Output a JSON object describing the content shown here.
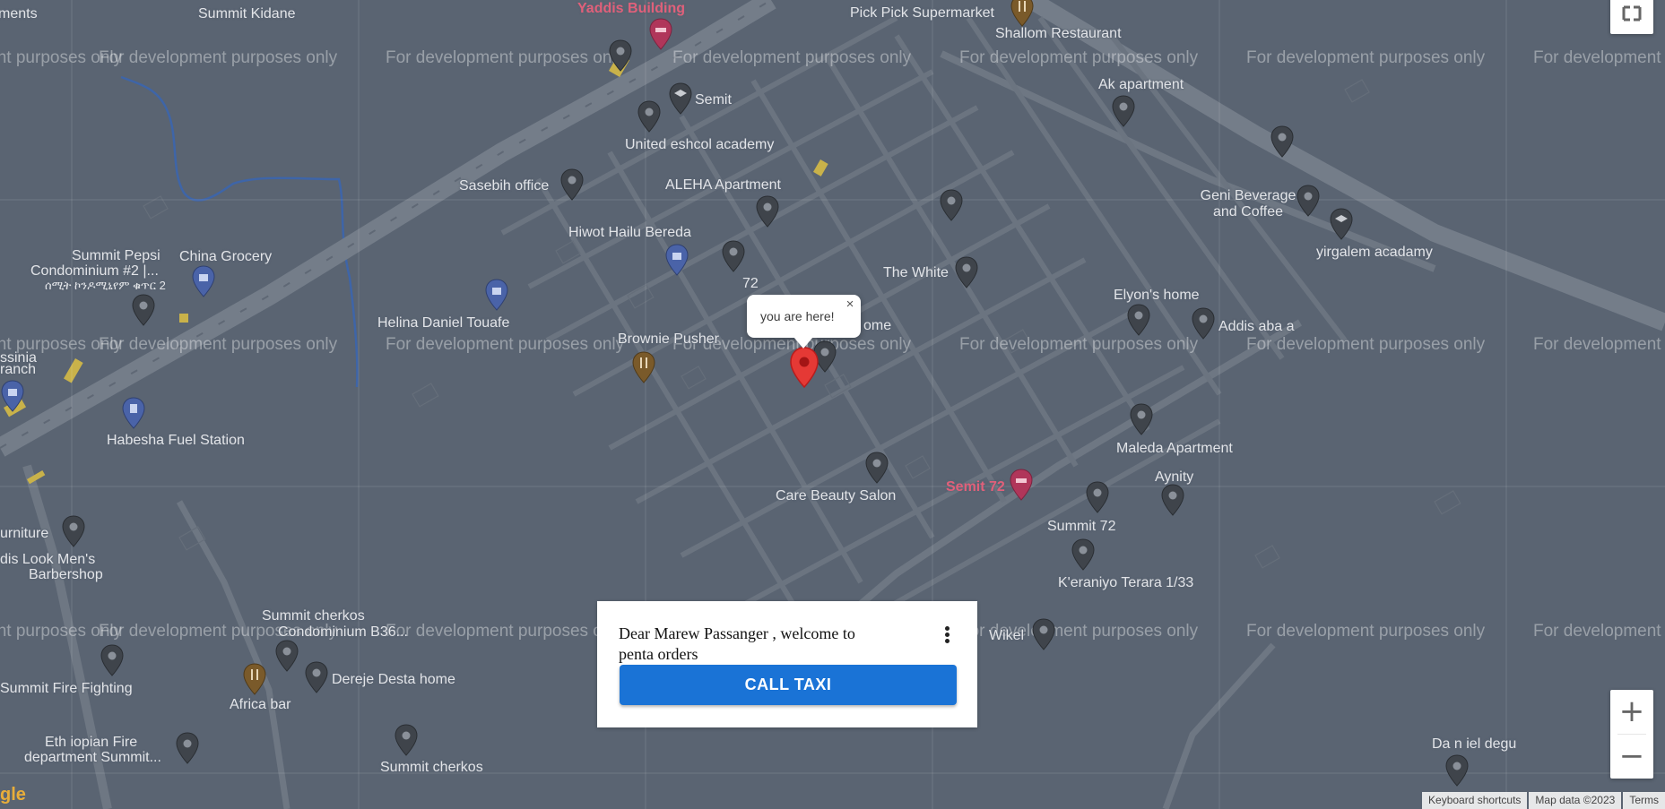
{
  "map": {
    "watermark": "For development purposes only",
    "user_marker_label": "you are here!",
    "close_label": "×",
    "places": [
      {
        "label": "ments"
      },
      {
        "label": "Summit Kidane"
      },
      {
        "label": "Yaddis Building"
      },
      {
        "label": "Pick Pick Supermarket"
      },
      {
        "label": "Shallom Restaurant"
      },
      {
        "label": "Semit"
      },
      {
        "label": "United eshcol academy"
      },
      {
        "label": "Ak apartment"
      },
      {
        "label": "Sasebih office"
      },
      {
        "label": "ALEHA Apartment"
      },
      {
        "label": "Geni Beverage and Coffee"
      },
      {
        "label": "Hiwot Hailu Bereda"
      },
      {
        "label": "yirgalem acadamy"
      },
      {
        "label": "Summit Pepsi"
      },
      {
        "label": "China Grocery"
      },
      {
        "label": "Condominium #2 |..."
      },
      {
        "label": "ሰሚት ኮንዶሚኒየም ቁጥር 2"
      },
      {
        "label": "72"
      },
      {
        "label": "The White"
      },
      {
        "label": "Elyon's home"
      },
      {
        "label": "Helina Daniel Touafe"
      },
      {
        "label": "Addis aba a"
      },
      {
        "label": "Brownie Pusher"
      },
      {
        "label": "ome"
      },
      {
        "label": "ssinia"
      },
      {
        "label": "ranch"
      },
      {
        "label": "Habesha Fuel Station"
      },
      {
        "label": "Maleda Apartment"
      },
      {
        "label": "Aynity"
      },
      {
        "label": "Care Beauty Salon"
      },
      {
        "label": "Semit 72"
      },
      {
        "label": "Summit 72"
      },
      {
        "label": "urniture"
      },
      {
        "label": "dis Look Men's"
      },
      {
        "label": "Barbershop"
      },
      {
        "label": "K'eraniyo Terara 1/33"
      },
      {
        "label": "Summit cherkos"
      },
      {
        "label": "Condominium B36..."
      },
      {
        "label": "Wikel"
      },
      {
        "label": "Dereje Desta home"
      },
      {
        "label": "Summit Fire Fighting"
      },
      {
        "label": "Africa bar"
      },
      {
        "label": "Eth iopian Fire"
      },
      {
        "label": "department Summit..."
      },
      {
        "label": "Summit cherkos"
      },
      {
        "label": "Da n iel degu"
      }
    ]
  },
  "controls": {
    "fullscreen_icon": "fullscreen-icon",
    "zoom_in_label": "+",
    "zoom_out_label": "−"
  },
  "footer": {
    "keyboard": "Keyboard shortcuts",
    "mapdata": "Map data ©2023",
    "terms": "Terms",
    "google": "gle"
  },
  "card": {
    "welcome": "Dear Marew Passanger , welcome to penta orders",
    "menu_icon": "more-vert-icon",
    "call_taxi": "CALL TAXI"
  },
  "colors": {
    "map_bg": "#5a6472",
    "road": "#707985",
    "pin_gray": "#3f444b",
    "pin_red": "#e53935",
    "button_blue": "#1a73d6"
  }
}
